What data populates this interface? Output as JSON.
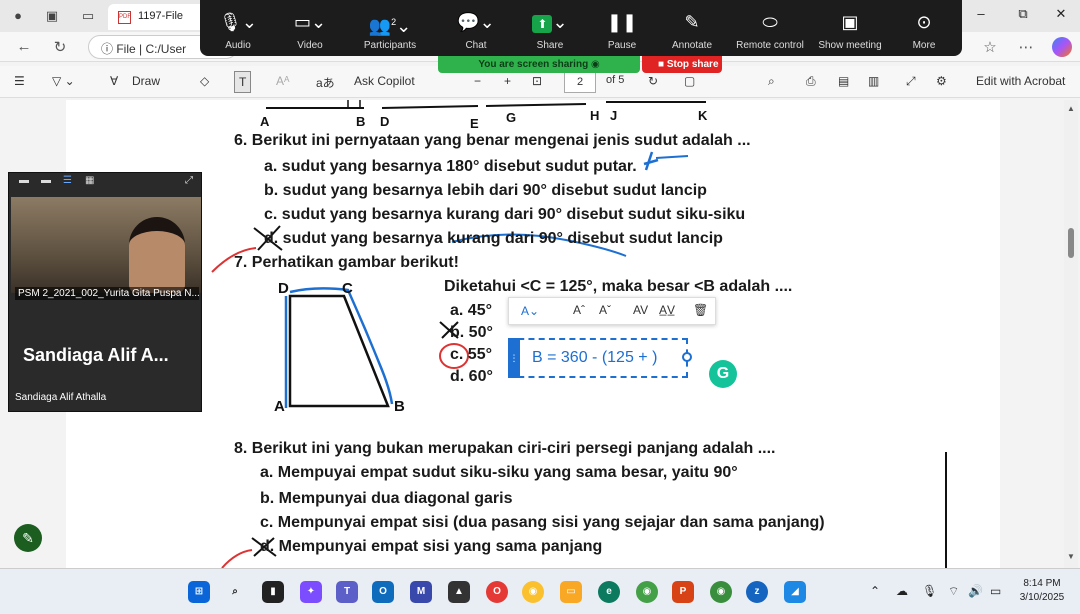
{
  "browser": {
    "tab_title": "1197-File",
    "address": "File  |  C:/User",
    "window_controls": [
      "–",
      "⧉",
      "✕"
    ]
  },
  "zoom": {
    "buttons": [
      {
        "label": "Audio",
        "icon": "microphone-icon"
      },
      {
        "label": "Video",
        "icon": "video-camera-icon"
      },
      {
        "label": "Participants",
        "icon": "participants-icon",
        "count": "2"
      },
      {
        "label": "Chat",
        "icon": "chat-icon"
      },
      {
        "label": "Share",
        "icon": "share-screen-icon"
      },
      {
        "label": "Pause",
        "icon": "pause-icon"
      },
      {
        "label": "Annotate",
        "icon": "annotate-pen-icon"
      },
      {
        "label": "Remote control",
        "icon": "mouse-icon"
      },
      {
        "label": "Show meeting",
        "icon": "meeting-window-icon"
      },
      {
        "label": "More",
        "icon": "more-dots-icon"
      }
    ],
    "sharing_banner": "You are screen sharing",
    "stop_share": "Stop share"
  },
  "pdf_toolbar": {
    "draw": "Draw",
    "ask_copilot": "Ask Copilot",
    "page_current": "2",
    "page_total": "of 5",
    "edit_acrobat": "Edit with Acrobat"
  },
  "document": {
    "top_labels": [
      "A",
      "B",
      "D",
      "E",
      "G",
      "H",
      "J",
      "K"
    ],
    "q6": {
      "question": "6. Berikut ini pernyataan yang benar mengenai  jenis sudut adalah ...",
      "options": [
        "a.  sudut yang besarnya 180° disebut sudut putar.",
        "b.  sudut yang besarnya lebih dari 90° disebut sudut lancip",
        "c.  sudut yang besarnya kurang dari 90° disebut sudut siku-siku",
        "d.  sudut yang besarnya kurang dari 90° disebut sudut lancip"
      ]
    },
    "q7": {
      "question": "7. Perhatikan gambar berikut!",
      "prompt": "Diketahui <C = 125°, maka besar <B adalah ....",
      "options": [
        "a. 45°",
        "b. 50°",
        "c. 55°",
        "d. 60°"
      ],
      "figure_labels": [
        "D",
        "C",
        "A",
        "B"
      ]
    },
    "formula_box": "B = 360 - (125 + )",
    "q8": {
      "question": "8. Berikut ini yang bukan merupakan ciri-ciri persegi panjang adalah ....",
      "options": [
        "a.  Mempuyai empat sudut siku-siku yang sama besar, yaitu 90°",
        "b.  Mempunyai dua diagonal garis",
        "c.  Mempunyai empat sisi (dua pasang sisi yang sejajar dan sama panjang)",
        "d.  Mempunyai empat sisi yang sama panjang"
      ]
    }
  },
  "participant": {
    "video_name_tag": "PSM 2_2021_002_Yurita Gita Puspa N...",
    "display_name": "Sandiaga Alif A...",
    "full_name": "Sandiaga Alif Athalla"
  },
  "taskbar": {
    "time": "8:14 PM",
    "date": "3/10/2025"
  },
  "colors": {
    "zoom_bg": "#1c1c1c",
    "share_green": "#2fb24c",
    "stop_red": "#e02424",
    "ink_blue": "#1d6fd1",
    "ink_red": "#d33"
  }
}
